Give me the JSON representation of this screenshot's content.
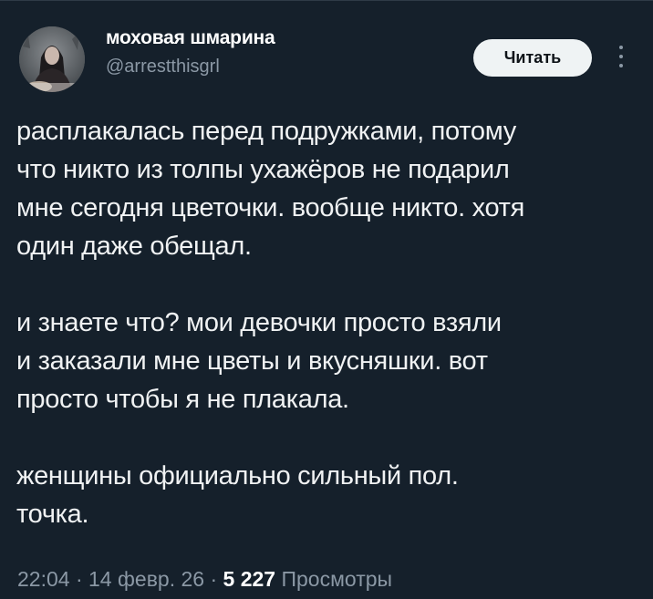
{
  "author": {
    "display_name": "моховая шмарина",
    "handle": "@arrestthisgrl"
  },
  "actions": {
    "follow_label": "Читать",
    "more_icon": "more-vertical-icon"
  },
  "tweet": {
    "paragraphs": [
      [
        "расплакалась перед подружками, потому",
        "что никто из толпы ухажёров не подарил",
        "мне сегодня цветочки. вообще никто. хотя",
        "один даже обещал."
      ],
      [
        "и знаете что? мои девочки просто взяли",
        "и заказали мне цветы и вкусняшки. вот",
        "просто чтобы я не плакала."
      ],
      [
        "женщины официально сильный пол.",
        "точка."
      ]
    ]
  },
  "meta": {
    "time": "22:04",
    "separator": "·",
    "date": "14 февр. 26",
    "views_count": "5 227",
    "views_label": "Просмотры"
  },
  "colors": {
    "background": "#15202b",
    "text": "#f0f2f3",
    "secondary": "#8b98a5",
    "button_bg": "#eff3f4"
  }
}
